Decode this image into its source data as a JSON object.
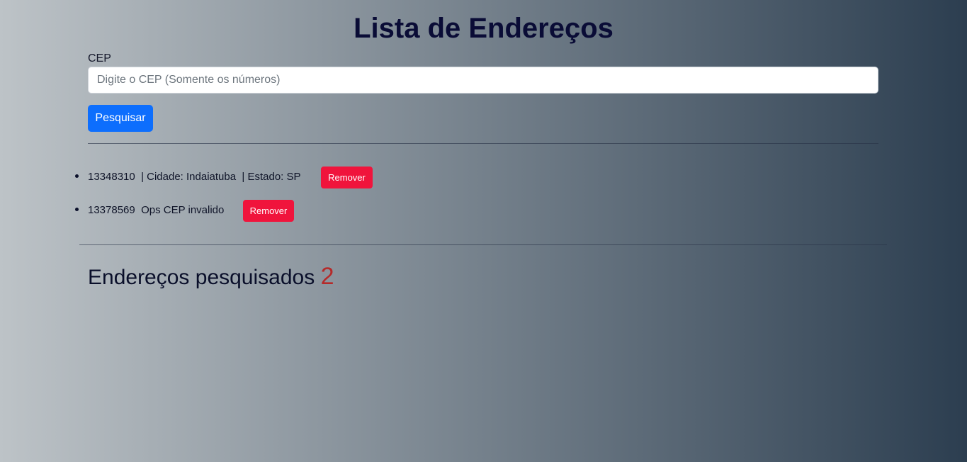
{
  "page": {
    "title": "Lista de Endereços"
  },
  "form": {
    "cep_label": "CEP",
    "cep_placeholder": "Digite o CEP (Somente os números)",
    "cep_value": "",
    "search_label": "Pesquisar"
  },
  "addresses": [
    {
      "text": "13348310  | Cidade: Indaiatuba  | Estado: SP",
      "remove_label": "Remover"
    },
    {
      "text": "13378569  Ops CEP invalido",
      "remove_label": "Remover"
    }
  ],
  "summary": {
    "label": "Endereços pesquisados",
    "count": "2"
  },
  "colors": {
    "background_gradient_start": "#bdc3c7",
    "background_gradient_end": "#2c3e50",
    "primary_button": "#0d6efd",
    "remove_button": "#f0143c",
    "counter": "#b52a2a"
  }
}
